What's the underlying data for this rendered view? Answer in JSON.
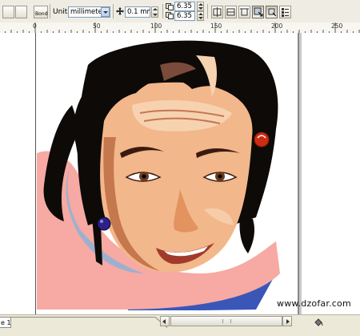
{
  "propbar": {
    "units_label": "Units:",
    "units_value": "millimeters",
    "nudge_value": "0.1 mm",
    "dup_x_value": "6.35 m",
    "dup_y_value": "6.35 m",
    "mode_button_label": "Bond"
  },
  "ruler": {
    "ticks": [
      "0",
      "50",
      "100",
      "150",
      "200",
      "250"
    ]
  },
  "bottombar": {
    "page_tab_label": "e 1"
  },
  "watermark": {
    "text": "www.dzofar.com"
  },
  "colors": {
    "hair": "#0d0a08",
    "hair_highlight": "#7a4a3a",
    "skin": "#f2b78a",
    "skin_shadow": "#c5774e",
    "skin_light": "#f7d2b0",
    "shirt_pink": "#f7a9a3",
    "shirt_blue": "#3a57b8",
    "hair_tie_red": "#cc2c12",
    "hair_tie_blue": "#2c208a"
  }
}
